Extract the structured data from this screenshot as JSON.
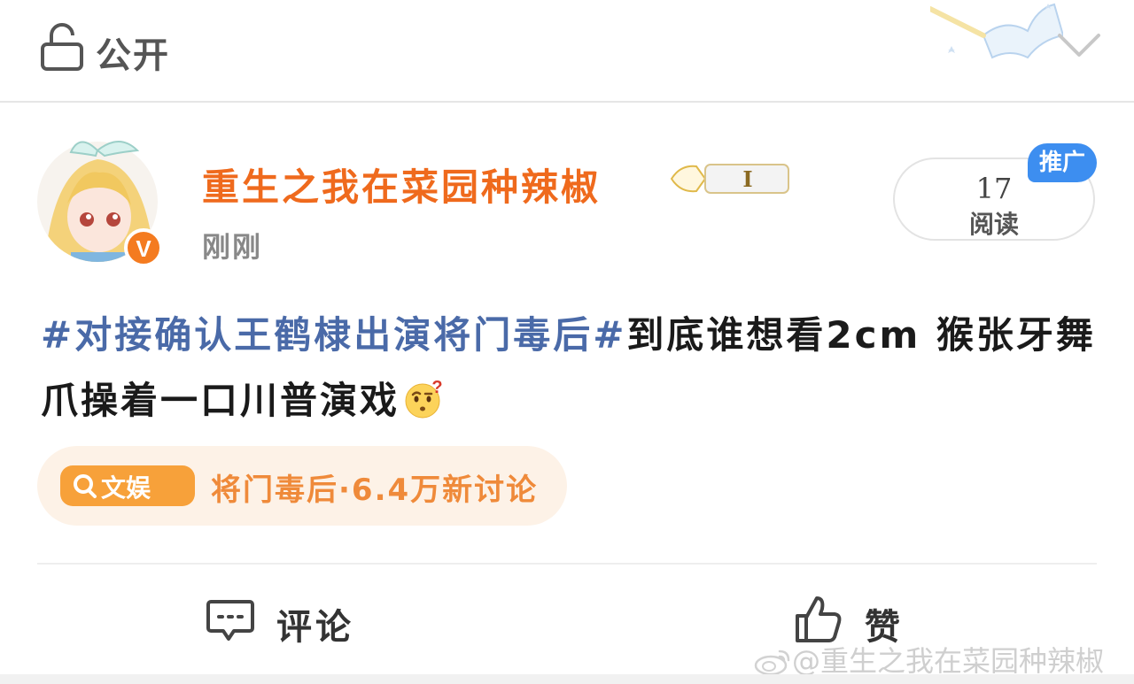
{
  "topbar": {
    "visibility_label": "公开"
  },
  "author": {
    "name": "重生之我在菜园种辣椒",
    "verified_mark": "V",
    "level": "I",
    "timestamp": "刚刚"
  },
  "stats": {
    "reads_count": "17",
    "reads_label": "阅读",
    "promo_label": "推广"
  },
  "post": {
    "hashtag": "#对接确认王鹤棣出演将门毒后#",
    "text_line": "到底谁想看2cm 猴张牙舞爪操着一口川普演戏",
    "emoji": "face-with-raised-eyebrow-question"
  },
  "topic": {
    "badge_label": "文娱",
    "text": "将门毒后·6.4万新讨论"
  },
  "actions": {
    "comment_label": "评论",
    "like_label": "赞"
  },
  "watermark": {
    "text": "@重生之我在菜园种辣椒"
  },
  "colors": {
    "accent_orange": "#ef6a1d",
    "hashtag_blue": "#4a6aa8",
    "promo_blue": "#3d8ef0",
    "topic_bg": "#fdf2e7"
  }
}
